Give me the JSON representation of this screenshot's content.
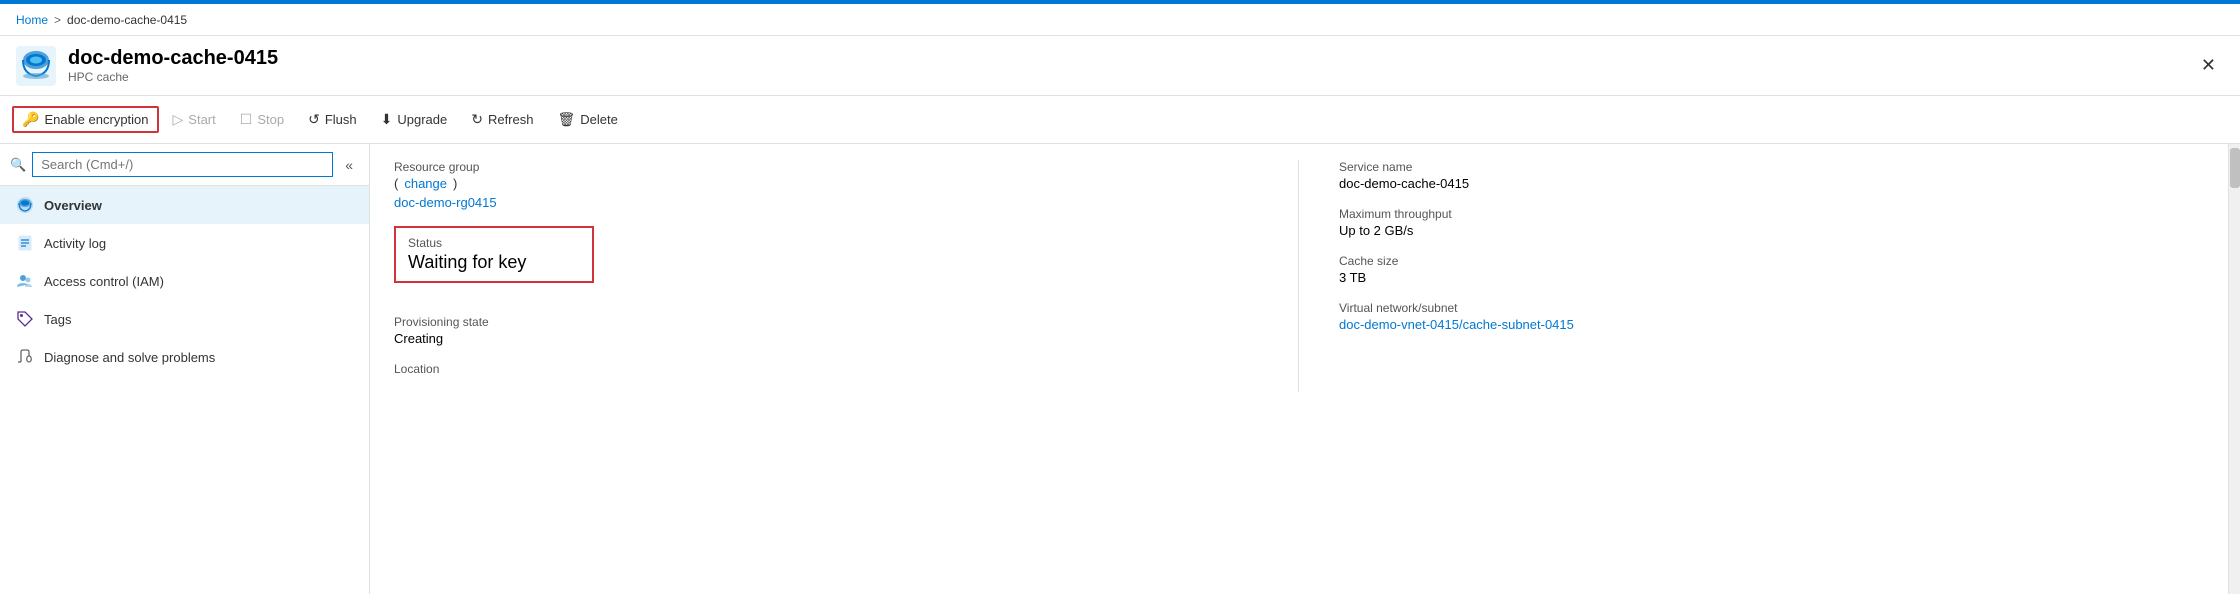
{
  "topBar": {},
  "breadcrumb": {
    "home": "Home",
    "sep": ">",
    "current": "doc-demo-cache-0415"
  },
  "header": {
    "title": "doc-demo-cache-0415",
    "subtitle": "HPC cache",
    "closeLabel": "✕"
  },
  "toolbar": {
    "enableEncryption": "Enable encryption",
    "start": "Start",
    "stop": "Stop",
    "flush": "Flush",
    "upgrade": "Upgrade",
    "refresh": "Refresh",
    "delete": "Delete"
  },
  "sidebar": {
    "searchPlaceholder": "Search (Cmd+/)",
    "collapseIcon": "«",
    "items": [
      {
        "label": "Overview",
        "icon": "☁",
        "active": true
      },
      {
        "label": "Activity log",
        "icon": "📋",
        "active": false
      },
      {
        "label": "Access control (IAM)",
        "icon": "👤",
        "active": false
      },
      {
        "label": "Tags",
        "icon": "🏷",
        "active": false
      },
      {
        "label": "Diagnose and solve problems",
        "icon": "🔧",
        "active": false
      }
    ]
  },
  "content": {
    "resourceGroup": {
      "label": "Resource group",
      "changeLink": "change",
      "valueLink": "doc-demo-rg0415"
    },
    "status": {
      "label": "Status",
      "value": "Waiting for key"
    },
    "provisioningState": {
      "label": "Provisioning state",
      "value": "Creating"
    },
    "location": {
      "label": "Location",
      "value": ""
    },
    "serviceName": {
      "label": "Service name",
      "value": "doc-demo-cache-0415"
    },
    "maxThroughput": {
      "label": "Maximum throughput",
      "value": "Up to 2 GB/s"
    },
    "cacheSize": {
      "label": "Cache size",
      "value": "3 TB"
    },
    "virtualNetwork": {
      "label": "Virtual network/subnet",
      "valueLink": "doc-demo-vnet-0415/cache-subnet-0415"
    }
  }
}
